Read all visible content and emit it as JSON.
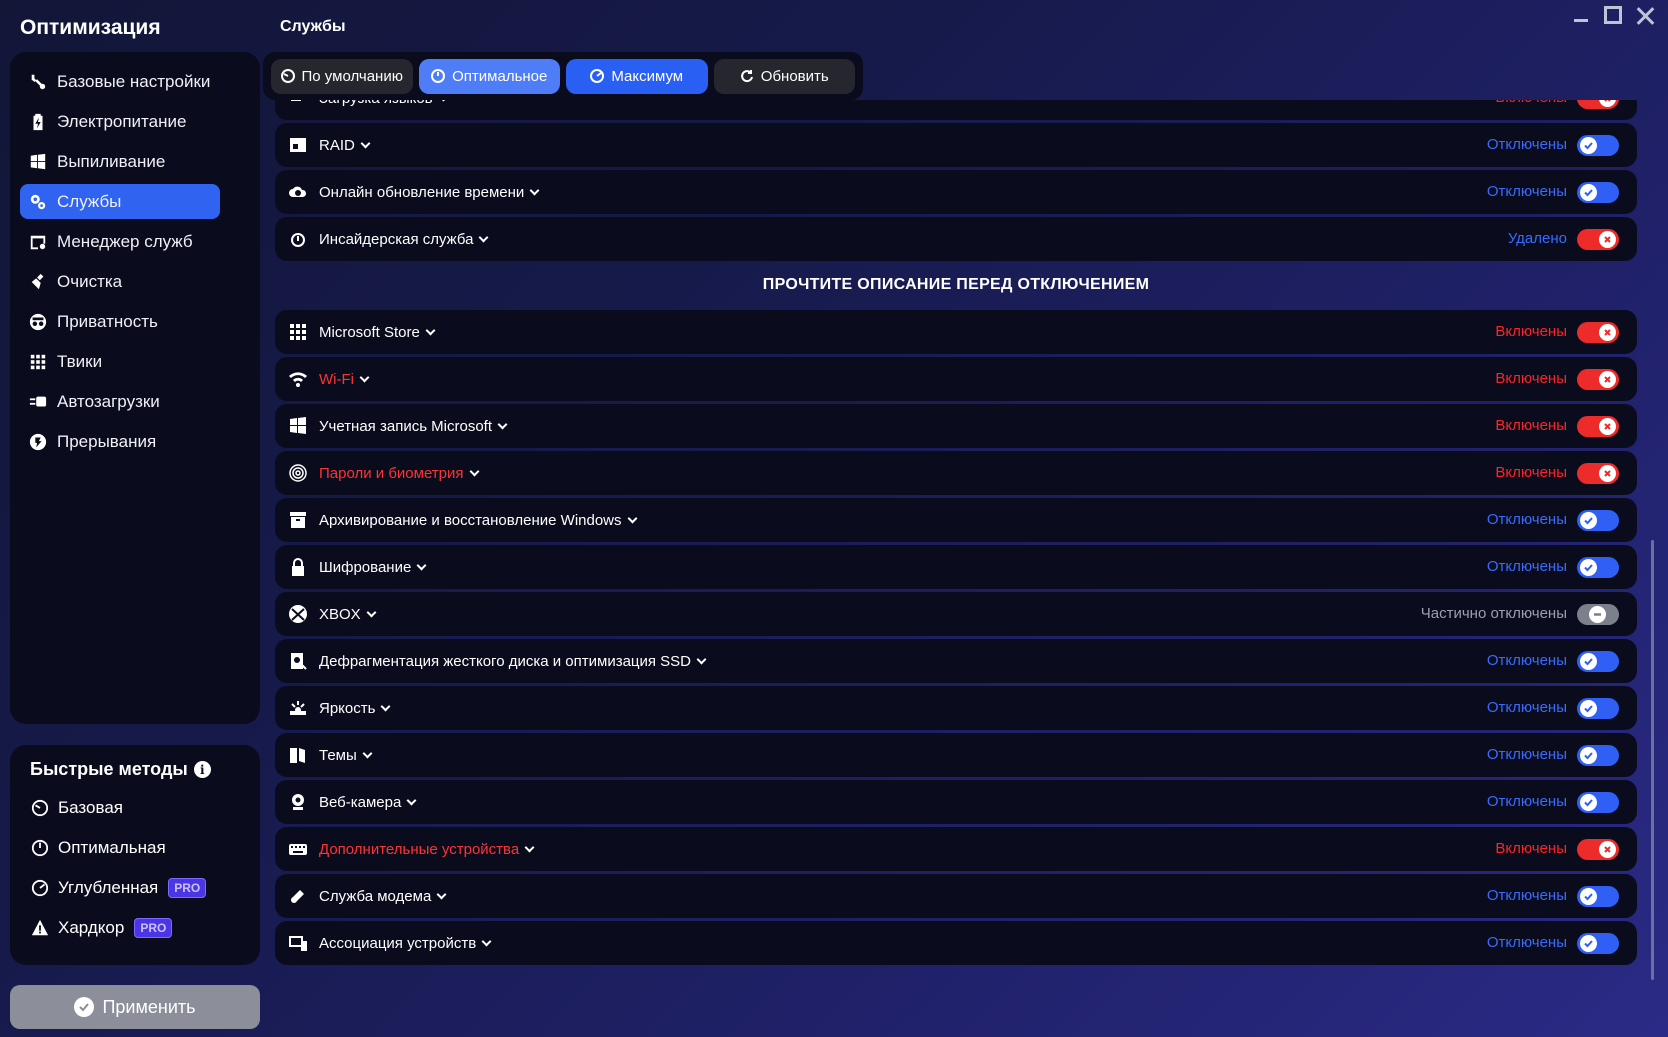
{
  "app": {
    "title": "Оптимизация"
  },
  "sidebar": {
    "items": [
      {
        "label": "Базовые настройки",
        "icon": "wrench-icon"
      },
      {
        "label": "Электропитание",
        "icon": "battery-icon"
      },
      {
        "label": "Выпиливание",
        "icon": "windows-icon"
      },
      {
        "label": "Службы",
        "icon": "gears-icon",
        "active": true
      },
      {
        "label": "Менеджер служб",
        "icon": "window-gear-icon"
      },
      {
        "label": "Очистка",
        "icon": "broom-icon"
      },
      {
        "label": "Приватность",
        "icon": "spy-icon"
      },
      {
        "label": "Твики",
        "icon": "grid-icon"
      },
      {
        "label": "Автозагрузки",
        "icon": "autostart-icon"
      },
      {
        "label": "Прерывания",
        "icon": "interrupt-icon"
      }
    ]
  },
  "quick": {
    "title": "Быстрые методы",
    "items": [
      {
        "label": "Базовая",
        "icon": "gauge-low-icon",
        "pro": ""
      },
      {
        "label": "Оптимальная",
        "icon": "gauge-mid-icon",
        "pro": ""
      },
      {
        "label": "Углубленная",
        "icon": "gauge-high-icon",
        "pro": "PRO"
      },
      {
        "label": "Хардкор",
        "icon": "warning-icon",
        "pro": "PRO"
      }
    ]
  },
  "apply": {
    "label": "Применить"
  },
  "page": {
    "title": "Службы"
  },
  "presets": [
    {
      "label": "По умолчанию"
    },
    {
      "label": "Оптимальное"
    },
    {
      "label": "Максимум"
    },
    {
      "label": "Обновить"
    }
  ],
  "section_heading": "ПРОЧТИТЕ ОПИСАНИЕ ПЕРЕД ОТКЛЮЧЕНИЕМ",
  "services": [
    {
      "name": "Загрузка языков",
      "status": "Включены",
      "state": "on",
      "warn": false,
      "icon": "language-icon"
    },
    {
      "name": "RAID",
      "status": "Отключены",
      "state": "off",
      "warn": false,
      "icon": "raid-icon"
    },
    {
      "name": "Онлайн обновление времени",
      "status": "Отключены",
      "state": "off",
      "warn": false,
      "icon": "cloud-time-icon"
    },
    {
      "name": "Инсайдерская служба",
      "status": "Удалено",
      "state": "on",
      "warn": false,
      "icon": "timer-icon"
    },
    {
      "name": "Microsoft Store",
      "status": "Включены",
      "state": "on",
      "warn": false,
      "icon": "apps-grid-icon"
    },
    {
      "name": "Wi-Fi",
      "status": "Включены",
      "state": "on",
      "warn": true,
      "icon": "wifi-icon"
    },
    {
      "name": "Учетная запись Microsoft",
      "status": "Включены",
      "state": "on",
      "warn": false,
      "icon": "windows-logo-icon"
    },
    {
      "name": "Пароли и биометрия",
      "status": "Включены",
      "state": "on",
      "warn": true,
      "icon": "fingerprint-icon"
    },
    {
      "name": "Архивирование и восстановление Windows",
      "status": "Отключены",
      "state": "off",
      "warn": false,
      "icon": "archive-icon"
    },
    {
      "name": "Шифрование",
      "status": "Отключены",
      "state": "off",
      "warn": false,
      "icon": "lock-icon"
    },
    {
      "name": "XBOX",
      "status": "Частично отключены",
      "state": "part",
      "warn": false,
      "icon": "xbox-icon"
    },
    {
      "name": "Дефрагментация жесткого диска и оптимизация SSD",
      "status": "Отключены",
      "state": "off",
      "warn": false,
      "icon": "defrag-icon"
    },
    {
      "name": "Яркость",
      "status": "Отключены",
      "state": "off",
      "warn": false,
      "icon": "brightness-icon"
    },
    {
      "name": "Темы",
      "status": "Отключены",
      "state": "off",
      "warn": false,
      "icon": "theme-icon"
    },
    {
      "name": "Веб-камера",
      "status": "Отключены",
      "state": "off",
      "warn": false,
      "icon": "webcam-icon"
    },
    {
      "name": "Дополнительные устройства",
      "status": "Включены",
      "state": "on",
      "warn": true,
      "icon": "keyboard-icon"
    },
    {
      "name": "Служба модема",
      "status": "Отключены",
      "state": "off",
      "warn": false,
      "icon": "modem-icon"
    },
    {
      "name": "Ассоциация устройств",
      "status": "Отключены",
      "state": "off",
      "warn": false,
      "icon": "devices-icon"
    }
  ],
  "colors": {
    "accent": "#2f63f0",
    "status_on": "#ff2424",
    "status_off": "#3a6bff",
    "status_partial": "#9aa0ad"
  }
}
